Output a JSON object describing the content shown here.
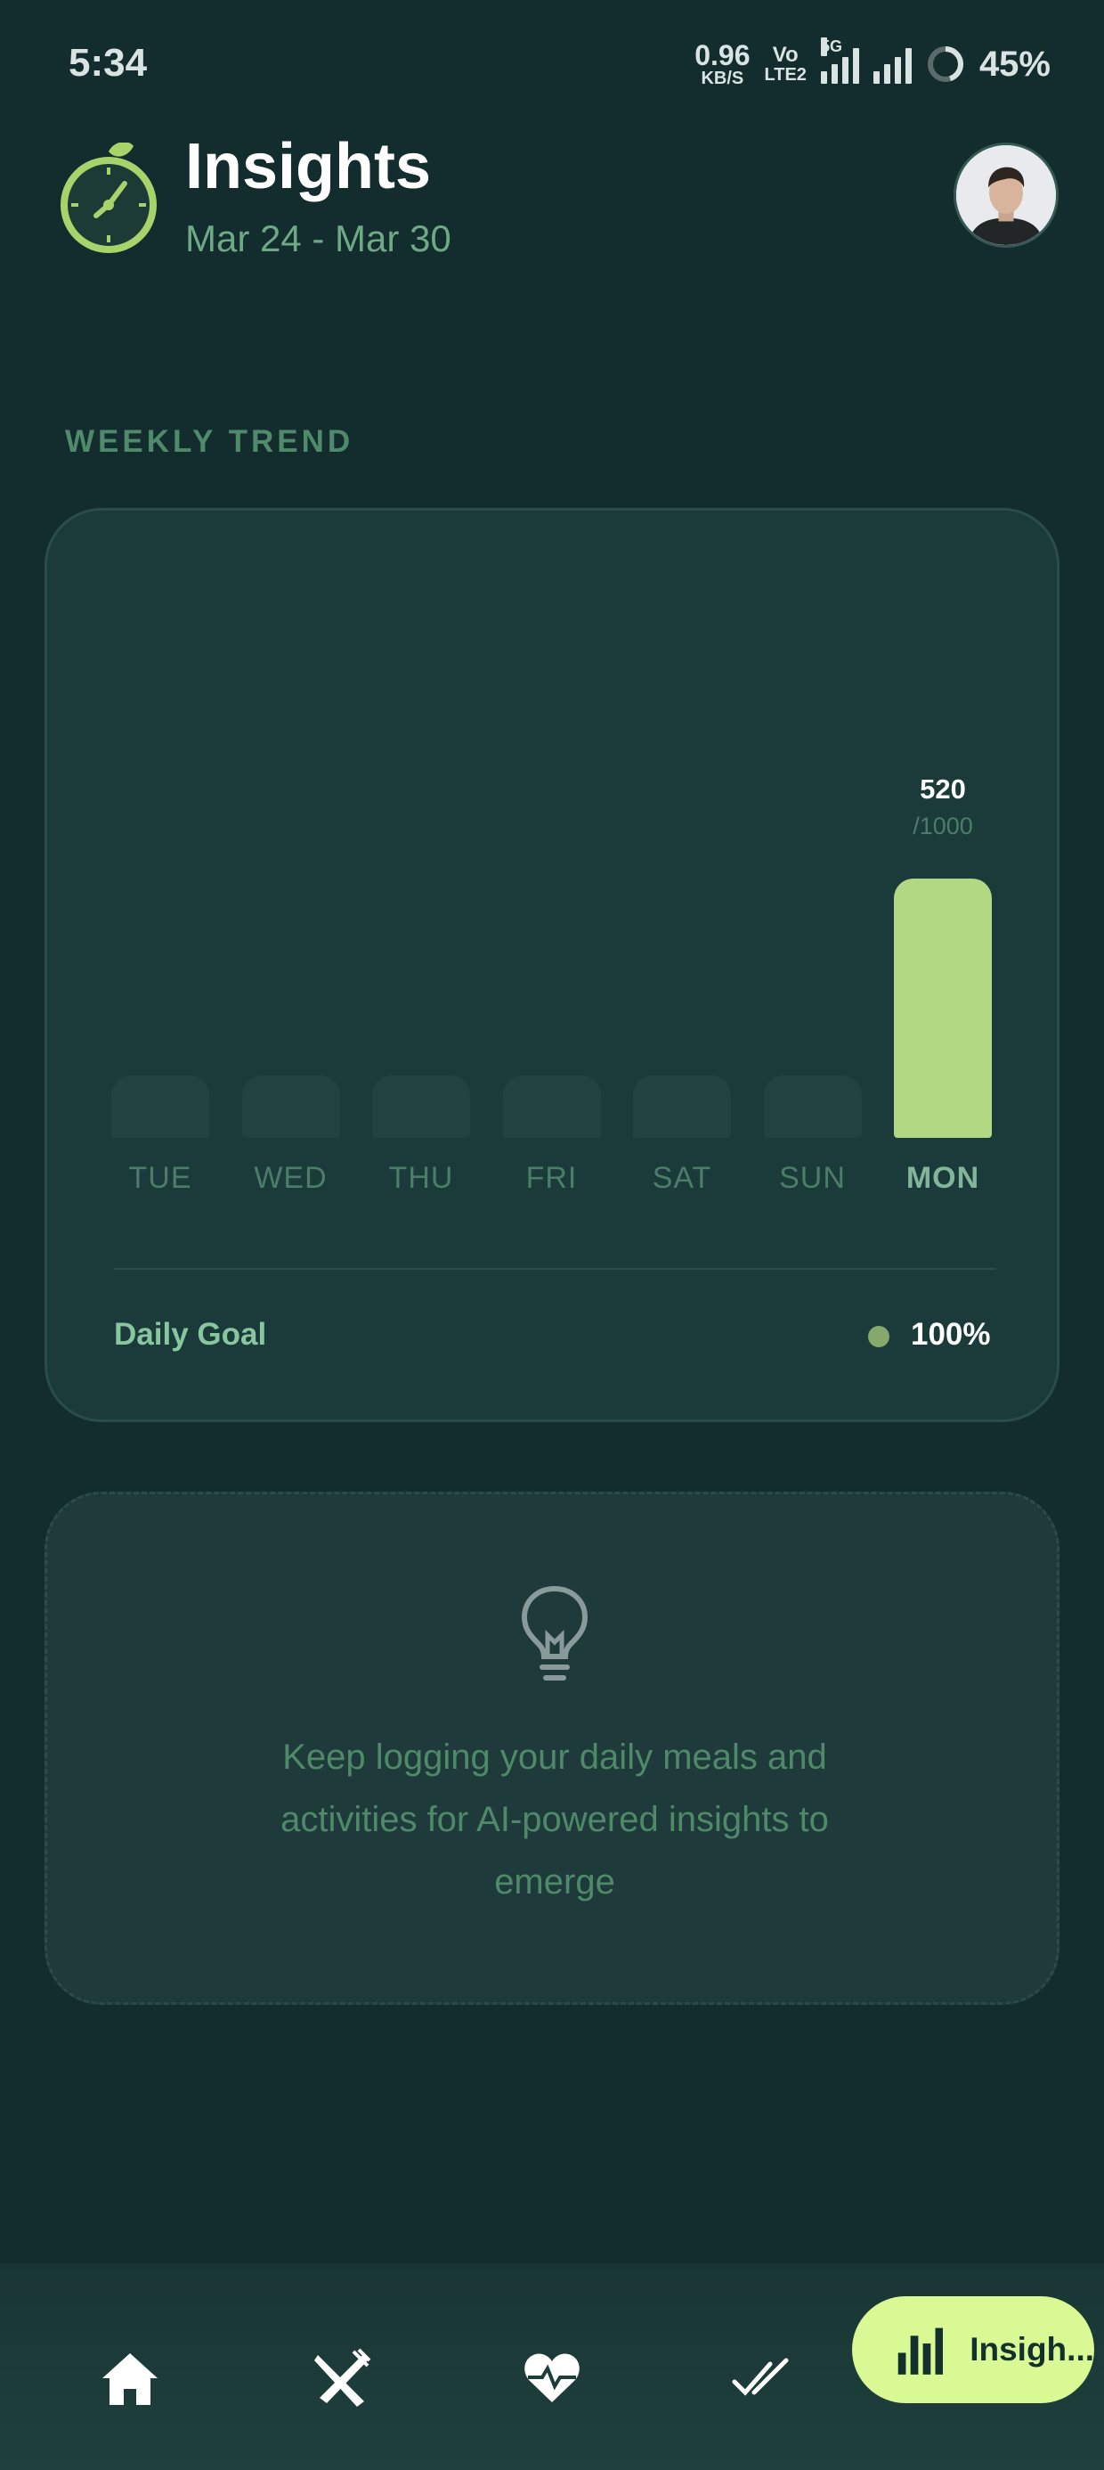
{
  "status_bar": {
    "time": "5:34",
    "net_speed_value": "0.96",
    "net_speed_unit": "KB/S",
    "volte_top": "Vo",
    "volte_bottom": "LTE2",
    "network_tag": "5G",
    "battery": "45%",
    "battery_level": 0.45
  },
  "header": {
    "title": "Insights",
    "date_range": "Mar 24 - Mar 30",
    "logo_icon": "stopwatch-leaf-icon",
    "avatar_icon": "user-avatar"
  },
  "weekly_trend": {
    "section_label": "WEEKLY TREND",
    "legend_label": "Daily Goal",
    "legend_value": "100%",
    "colors": {
      "active_bar": "#b2d883",
      "inactive_bar": "#21423f",
      "legend_dot": "#86a96b"
    }
  },
  "chart_data": {
    "type": "bar",
    "categories": [
      "TUE",
      "WED",
      "THU",
      "FRI",
      "SAT",
      "SUN",
      "MON"
    ],
    "values": [
      0,
      0,
      0,
      0,
      0,
      0,
      520
    ],
    "goal": 1000,
    "active_index": 6,
    "value_label": "520",
    "goal_label": "/1000",
    "title": "",
    "xlabel": "",
    "ylabel": ""
  },
  "tip": {
    "icon": "lightbulb-icon",
    "line1": "Keep logging your daily meals and",
    "line2": "activities for AI-powered insights to",
    "line3": "emerge"
  },
  "bottom_nav": {
    "items": [
      {
        "icon": "home-icon"
      },
      {
        "icon": "utensils-icon"
      },
      {
        "icon": "heart-pulse-icon"
      },
      {
        "icon": "double-check-icon"
      }
    ],
    "active_label": "Insigh...",
    "active_icon": "bar-chart-icon",
    "accent": "#d8f994"
  }
}
